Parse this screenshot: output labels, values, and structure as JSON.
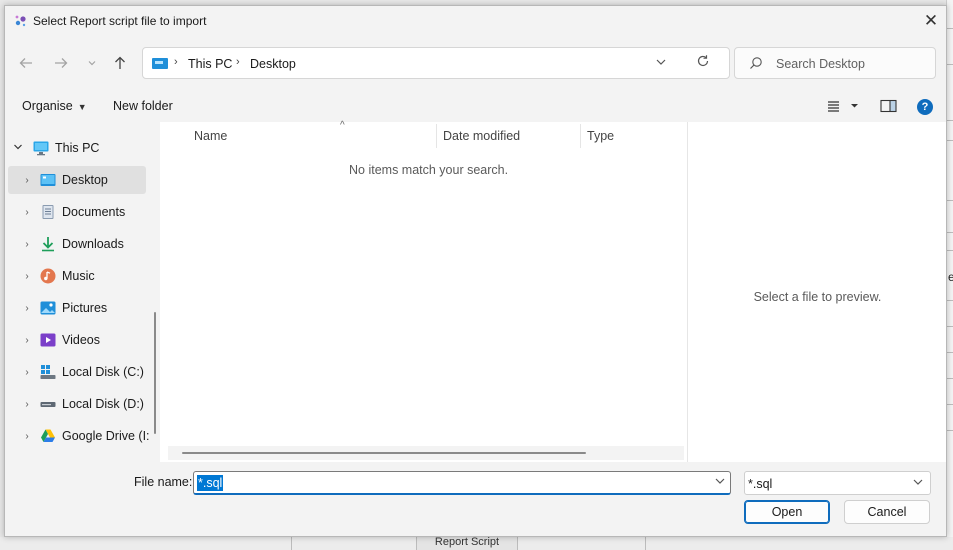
{
  "window": {
    "title": "Select Report script file to import",
    "close_label": "✕"
  },
  "navigation": {
    "back_icon": "arrow-left-icon",
    "forward_icon": "arrow-right-icon",
    "recent_icon": "chevron-down-icon",
    "up_icon": "arrow-up-icon",
    "breadcrumb": [
      "This PC",
      "Desktop"
    ],
    "search_placeholder": "Search Desktop"
  },
  "commands": {
    "organise": "Organise",
    "new_folder": "New folder"
  },
  "nav_pane": {
    "items": [
      {
        "label": "This PC",
        "icon": "monitor-icon",
        "level": 0,
        "expanded": true
      },
      {
        "label": "Desktop",
        "icon": "desktop-icon",
        "level": 1,
        "selected": true
      },
      {
        "label": "Documents",
        "icon": "documents-icon",
        "level": 1
      },
      {
        "label": "Downloads",
        "icon": "download-icon",
        "level": 1
      },
      {
        "label": "Music",
        "icon": "music-icon",
        "level": 1
      },
      {
        "label": "Pictures",
        "icon": "pictures-icon",
        "level": 1
      },
      {
        "label": "Videos",
        "icon": "videos-icon",
        "level": 1
      },
      {
        "label": "Local Disk (C:)",
        "icon": "windows-drive-icon",
        "level": 1
      },
      {
        "label": "Local Disk (D:)",
        "icon": "drive-icon",
        "level": 1
      },
      {
        "label": "Google Drive (I:",
        "icon": "google-drive-icon",
        "level": 1
      }
    ]
  },
  "file_list": {
    "columns": [
      "Name",
      "Date modified",
      "Type"
    ],
    "empty_message": "No items match your search."
  },
  "preview": {
    "message": "Select a file to preview."
  },
  "footer": {
    "file_name_label": "File name:",
    "file_name_value": "*.sql",
    "filter_value": "*.sql",
    "open_label": "Open",
    "cancel_label": "Cancel"
  },
  "background": {
    "tab_label": "Report Script",
    "right_glyph": "e"
  },
  "colors": {
    "accent": "#0f6cbd",
    "selection": "#0078d4",
    "dialog_bg": "#f3f3f3"
  }
}
